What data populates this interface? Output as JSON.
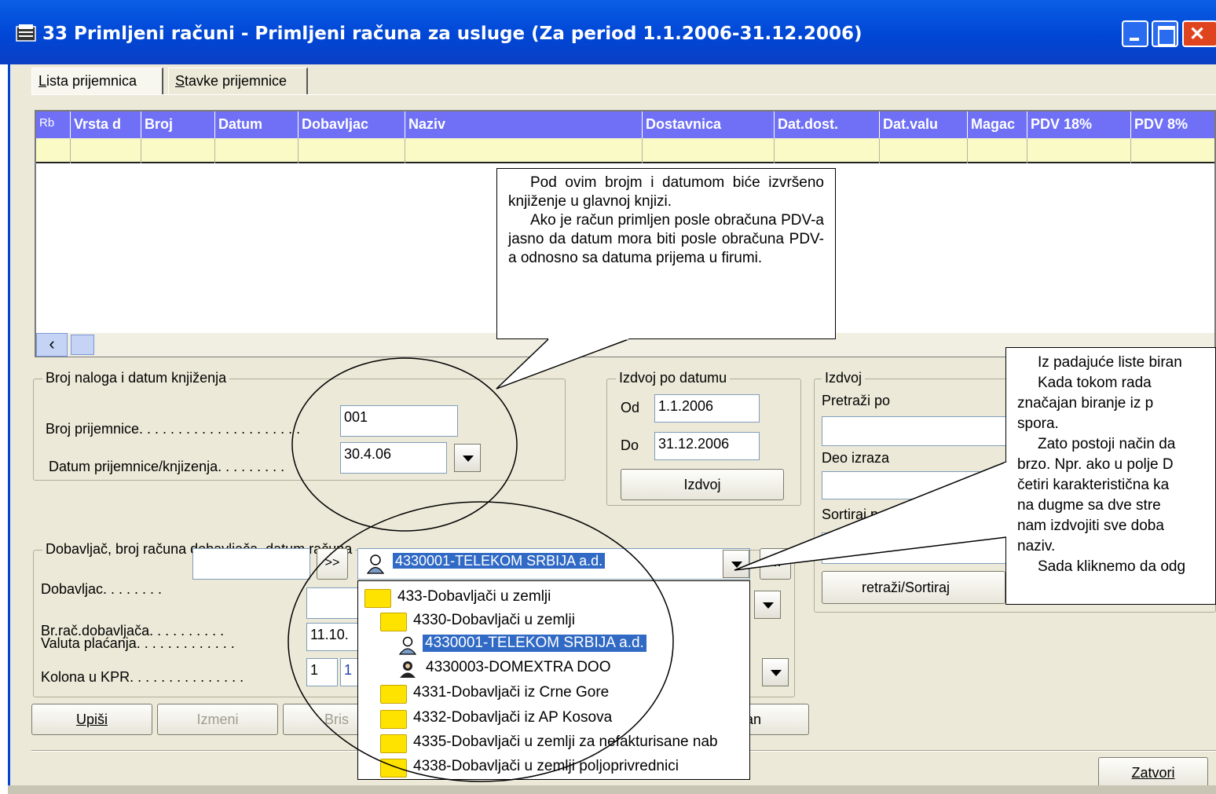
{
  "window": {
    "title": "33 Primljeni računi - Primljeni računa za usluge  (Za period 1.1.2006-31.12.2006)"
  },
  "tabs": [
    {
      "label": "Lista prijemnica",
      "u": "L",
      "rest": "ista prijemnica"
    },
    {
      "label": "Stavke prijemnice",
      "u": "S",
      "rest": "tavke prijemnice"
    }
  ],
  "grid": {
    "columns": [
      "Rb",
      "Vrsta d",
      "Broj",
      "Datum",
      "Dobavljac",
      "Naziv",
      "Dostavnica",
      "Dat.dost.",
      "Dat.valu",
      "Magac",
      "PDV 18%",
      "PDV 8%"
    ]
  },
  "booking": {
    "group_title": "Broj naloga i datum knjiženja",
    "receipt_number_label": "Broj prijemnice. . . . . . . . . . . . . . . . . . . . .",
    "receipt_number_value": "001",
    "receipt_date_label": "Datum prijemnice/knjizenja. . . . . . . . .",
    "receipt_date_value": "30.4.06"
  },
  "date_filter": {
    "group_title": "Izdvoj po datumu",
    "from_label": "Od",
    "from_value": "1.1.2006",
    "to_label": "Do",
    "to_value": "31.12.2006",
    "button": "Izdvoj"
  },
  "search": {
    "group_title": "Izdvoj",
    "search_by_label": "Pretraži po",
    "search_by_value": "",
    "expr_label": "Deo izraza",
    "sort_label": "Sortiraj po",
    "button": "Pretraži/Sortiraj",
    "button_visible": "retraži/Sortiraj"
  },
  "supplier": {
    "group_title": "Dobavljač, broj računa dobavljača, datum računa",
    "supplier_label": "Dobavljac. . . . . . . .",
    "supplier_code": "",
    "forward_button": ">>",
    "selected_supplier": "4330001-TELEKOM SRBIJA a.d.",
    "ellipsis_button": "...",
    "invoice_no_label": "Br.rač.dobavljača. . . . . . . . . .",
    "currency_date_label": "Valuta plaćanja. . . . . . . . . . . . .",
    "currency_date_value": "11.10.",
    "kpr_label": "Kolona u KPR. . . . . . . . . . . . . . .",
    "kpr_value1": "1",
    "kpr_value2": "1"
  },
  "dropdown_items": [
    {
      "label": "433-Dobavljači u zemlji",
      "icon": "folder-icon",
      "level": 0
    },
    {
      "label": "4330-Dobavljači u zemlji",
      "icon": "folder-icon",
      "level": 1
    },
    {
      "label": "4330001-TELEKOM SRBIJA a.d.",
      "icon": "person-icon",
      "level": 2,
      "selected": true
    },
    {
      "label": "4330003-DOMEXTRA DOO",
      "icon": "person-icon",
      "level": 2
    },
    {
      "label": "4331-Dobavljači iz Crne Gore",
      "icon": "folder-icon",
      "level": 1
    },
    {
      "label": "4332-Dobavljači iz AP Kosova",
      "icon": "folder-icon",
      "level": 1
    },
    {
      "label": "4335-Dobavljači u zemlji za nefakturisane nab",
      "icon": "folder-icon",
      "level": 1
    },
    {
      "label": "4338-Dobavljači u zemlji poljoprivrednici",
      "icon": "folder-icon",
      "level": 1
    }
  ],
  "buttons": {
    "write": "Upiši",
    "edit": "Izmeni",
    "delete": "Bris",
    "partial": "an",
    "close": "Zatvori"
  },
  "callouts": {
    "left": [
      "Pod ovim brojm i datumom biće izvršeno knjiženje u glavnoj knjizi.",
      "Ako je račun primljen posle obračuna PDV-a jasno da datum mora biti posle obračuna PDV-a odnosno sa datuma prijema u firumi."
    ],
    "right": [
      "Iz padajuće liste biran",
      "Kada tokom rada",
      "značajan biranje iz p",
      "spora.",
      "Zato postoji način da",
      "brzo. Npr. ako u polje D",
      "četiri karakteristična ka",
      "na dugme sa dve stre",
      "nam izdvojiti sve doba",
      "naziv.",
      "Sada kliknemo da odg"
    ]
  },
  "colors": {
    "titlebar": "#0046d5",
    "grid_header": "#6f70f5",
    "grid_row": "#fafac7",
    "selection": "#316ac5",
    "dialog_bg": "#ece9d8"
  }
}
